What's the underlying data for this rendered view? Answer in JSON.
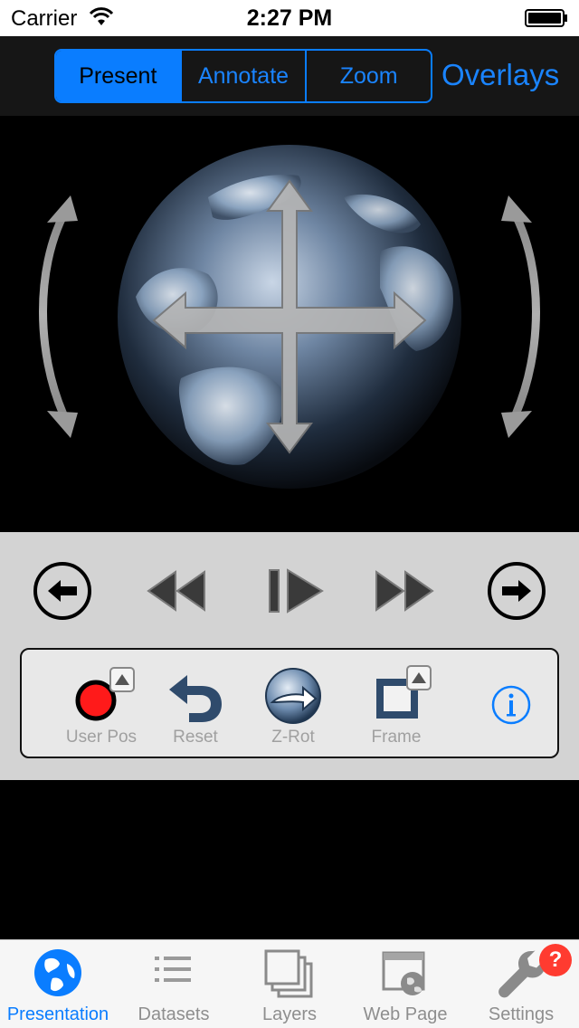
{
  "status_bar": {
    "carrier": "Carrier",
    "time": "2:27 PM"
  },
  "toolbar": {
    "segments": [
      {
        "label": "Present",
        "active": true
      },
      {
        "label": "Annotate",
        "active": false
      },
      {
        "label": "Zoom",
        "active": false
      }
    ],
    "overlays_label": "Overlays"
  },
  "colors": {
    "accent": "#0a7dff",
    "panel": "#d3d3d3",
    "record": "#ff1a1a",
    "badge": "#ff3b30"
  },
  "playback": {
    "buttons": [
      "prev-arrow-icon",
      "rewind-icon",
      "play-pause-icon",
      "fast-forward-icon",
      "next-arrow-icon"
    ]
  },
  "tools": [
    {
      "label": "User Pos",
      "icon": "record-dot-icon"
    },
    {
      "label": "Reset",
      "icon": "undo-arrow-icon"
    },
    {
      "label": "Z-Rot",
      "icon": "rotate-arrow-icon"
    },
    {
      "label": "Frame",
      "icon": "frame-icon"
    }
  ],
  "tabs": [
    {
      "label": "Presentation",
      "icon": "globe-icon",
      "active": true
    },
    {
      "label": "Datasets",
      "icon": "list-icon",
      "active": false
    },
    {
      "label": "Layers",
      "icon": "layers-icon",
      "active": false
    },
    {
      "label": "Web Page",
      "icon": "web-page-icon",
      "active": false
    },
    {
      "label": "Settings",
      "icon": "wrench-icon",
      "active": false,
      "badge": "?"
    }
  ]
}
